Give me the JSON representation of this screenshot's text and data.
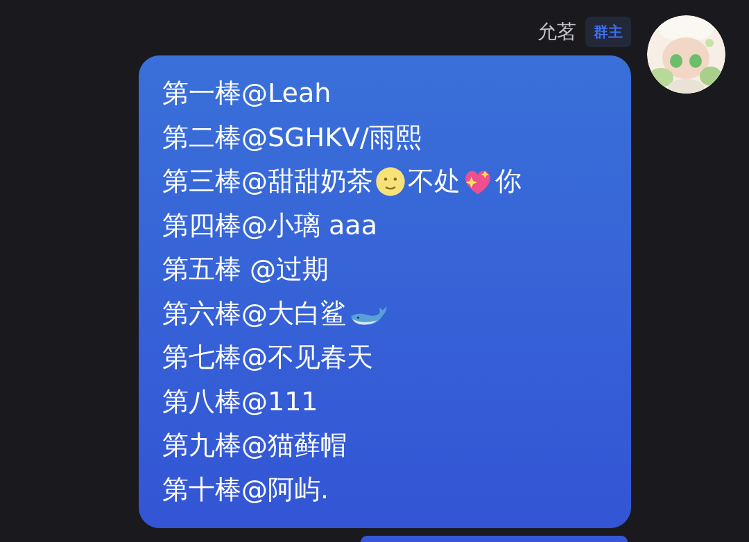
{
  "sender": {
    "name": "允茗",
    "badge": "群主"
  },
  "message": {
    "lines": [
      [
        {
          "kind": "text",
          "text": "第一棒@Leah"
        }
      ],
      [
        {
          "kind": "text",
          "text": "第二棒@SGHKV/雨熙"
        }
      ],
      [
        {
          "kind": "text",
          "text": "第三棒@甜甜奶茶"
        },
        {
          "kind": "moon"
        },
        {
          "kind": "text",
          "text": "不处"
        },
        {
          "kind": "heart"
        },
        {
          "kind": "text",
          "text": "你"
        }
      ],
      [
        {
          "kind": "text",
          "text": "第四棒@小璃 aaa"
        }
      ],
      [
        {
          "kind": "text",
          "text": "第五棒 @过期"
        }
      ],
      [
        {
          "kind": "text",
          "text": "第六棒@大白鲨"
        },
        {
          "kind": "whale"
        }
      ],
      [
        {
          "kind": "text",
          "text": "第七棒@不见春天"
        }
      ],
      [
        {
          "kind": "text",
          "text": "第八棒@111"
        }
      ],
      [
        {
          "kind": "text",
          "text": "第九棒@猫藓帽"
        }
      ],
      [
        {
          "kind": "text",
          "text": "第十棒@阿屿."
        }
      ]
    ]
  },
  "next_message": {
    "kind": "bubble"
  }
}
